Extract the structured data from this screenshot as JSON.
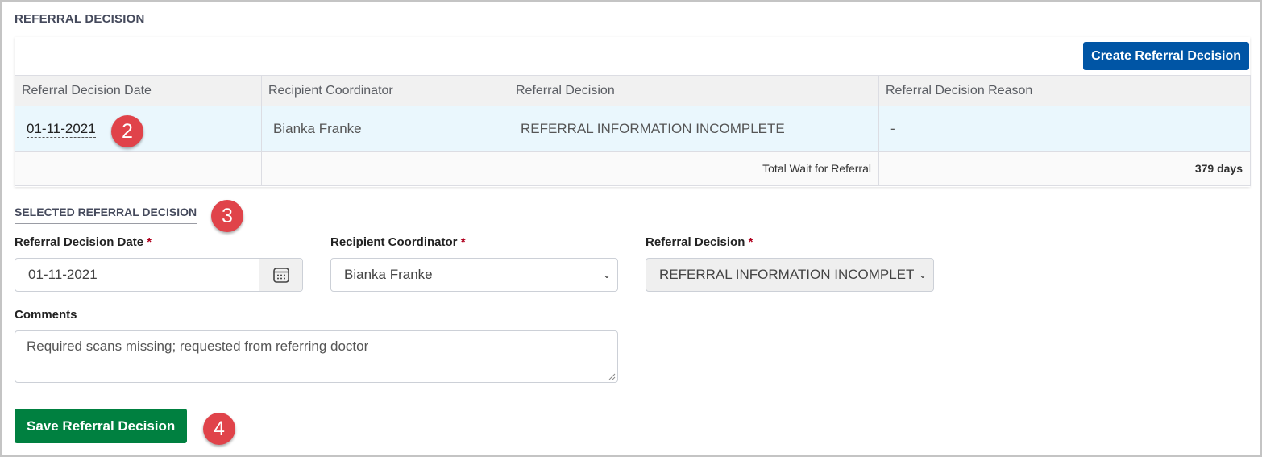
{
  "section": {
    "title": "REFERRAL DECISION"
  },
  "toolbar": {
    "create_label": "Create Referral Decision"
  },
  "table": {
    "headers": [
      "Referral Decision Date",
      "Recipient Coordinator",
      "Referral Decision",
      "Referral Decision Reason"
    ],
    "rows": [
      {
        "date": "01-11-2021",
        "coordinator": "Bianka Franke",
        "decision": "REFERRAL INFORMATION INCOMPLETE",
        "reason": "-"
      }
    ],
    "total_label": "Total Wait for Referral",
    "total_value": "379 days"
  },
  "selected": {
    "title": "SELECTED REFERRAL DECISION",
    "date_label": "Referral Decision Date",
    "date_value": "01-11-2021",
    "coordinator_label": "Recipient Coordinator",
    "coordinator_value": "Bianka Franke",
    "decision_label": "Referral Decision",
    "decision_value": "REFERRAL INFORMATION INCOMPLETE",
    "required_mark": "*",
    "comments_label": "Comments",
    "comments_value": "Required scans missing; requested from referring doctor",
    "save_label": "Save Referral Decision"
  },
  "annotations": {
    "badge_2": "2",
    "badge_3": "3",
    "badge_4": "4"
  },
  "colors": {
    "primary": "#0055a5",
    "success": "#008040",
    "badge": "#e0434a",
    "required": "#b0001e"
  }
}
